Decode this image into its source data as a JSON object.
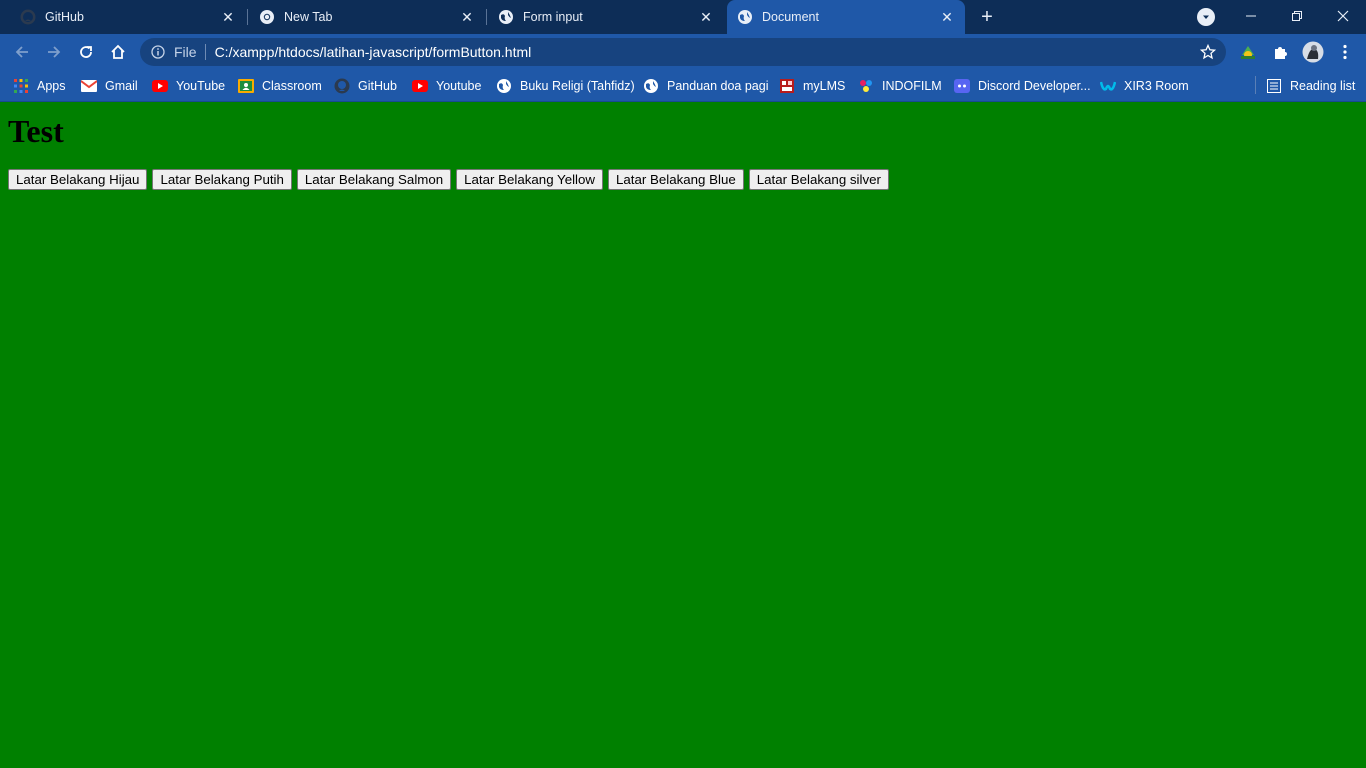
{
  "tabs": [
    {
      "title": "GitHub",
      "icon": "github-icon"
    },
    {
      "title": "New Tab",
      "icon": "chrome-icon"
    },
    {
      "title": "Form input",
      "icon": "globe-icon"
    },
    {
      "title": "Document",
      "icon": "globe-icon",
      "active": true
    }
  ],
  "address_bar": {
    "chip": "File",
    "url": "C:/xampp/htdocs/latihan-javascript/formButton.html"
  },
  "bookmarks": [
    {
      "label": "Apps",
      "icon": "apps-grid-icon"
    },
    {
      "label": "Gmail",
      "icon": "gmail-icon"
    },
    {
      "label": "YouTube",
      "icon": "youtube-icon"
    },
    {
      "label": "Classroom",
      "icon": "classroom-icon"
    },
    {
      "label": "GitHub",
      "icon": "github-icon"
    },
    {
      "label": "Youtube",
      "icon": "youtube-icon"
    },
    {
      "label": "Buku Religi (Tahfidz)",
      "icon": "globe-icon"
    },
    {
      "label": "Panduan doa pagi",
      "icon": "globe-icon"
    },
    {
      "label": "myLMS",
      "icon": "mylms-icon"
    },
    {
      "label": "INDOFILM",
      "icon": "indofilm-icon"
    },
    {
      "label": "Discord Developer...",
      "icon": "discord-icon"
    },
    {
      "label": "XIR3 Room",
      "icon": "webex-icon"
    }
  ],
  "reading_list": "Reading list",
  "page": {
    "heading": "Test",
    "background_color": "#008000",
    "buttons": [
      "Latar Belakang Hijau",
      "Latar Belakang Putih",
      "Latar Belakang Salmon",
      "Latar Belakang Yellow",
      "Latar Belakang Blue",
      "Latar Belakang silver"
    ]
  }
}
